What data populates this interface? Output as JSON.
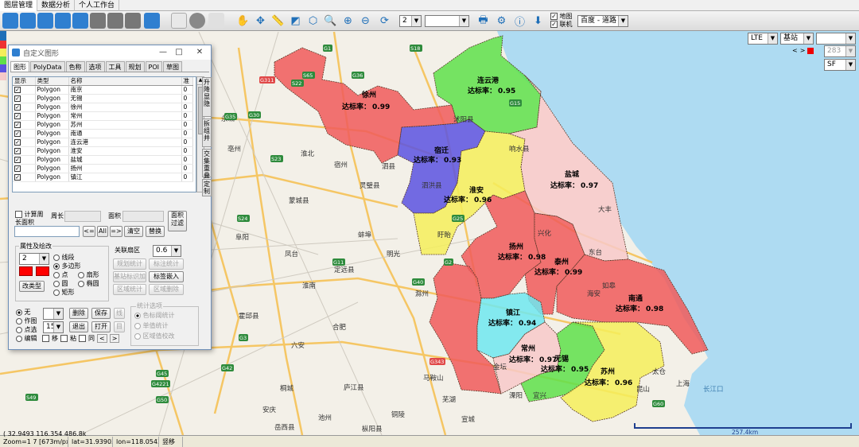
{
  "menu": {
    "tabs": [
      "图层管理",
      "数据分析",
      "个人工作台"
    ]
  },
  "toolbar": {
    "zoom_select": "2",
    "blank_select": "",
    "layer_map_label": "地图",
    "online_label": "联机",
    "basemap_select": "百度 - 道路"
  },
  "map_controls": {
    "network_select": "LTE",
    "site_select": "基站",
    "blank_select": "",
    "value_283": "283",
    "sf_select": "SF",
    "nav_arrows": [
      "<",
      ">"
    ]
  },
  "dialog": {
    "title": "自定义图形",
    "window_buttons": [
      "—",
      "□",
      "✕"
    ],
    "tabs": [
      "图形",
      "PolyData",
      "色称",
      "选项",
      "工具",
      "规划",
      "POI",
      "草图"
    ],
    "grid": {
      "headers": [
        "显示",
        "类型",
        "名称",
        "准"
      ],
      "rows": [
        {
          "type": "Polygon",
          "name": "南京",
          "v": "0"
        },
        {
          "type": "Polygon",
          "name": "无锡",
          "v": "0"
        },
        {
          "type": "Polygon",
          "name": "徐州",
          "v": "0"
        },
        {
          "type": "Polygon",
          "name": "常州",
          "v": "0"
        },
        {
          "type": "Polygon",
          "name": "苏州",
          "v": "0"
        },
        {
          "type": "Polygon",
          "name": "南通",
          "v": "0"
        },
        {
          "type": "Polygon",
          "name": "连云港",
          "v": "0"
        },
        {
          "type": "Polygon",
          "name": "淮安",
          "v": "0"
        },
        {
          "type": "Polygon",
          "name": "盐城",
          "v": "0"
        },
        {
          "type": "Polygon",
          "name": "扬州",
          "v": "0"
        },
        {
          "type": "Polygon",
          "name": "镇江",
          "v": "0"
        }
      ]
    },
    "side_buttons": [
      "升降显隐",
      "拆组并",
      "交集重叠",
      "定制"
    ],
    "calc_perimeter": "计算周长面积",
    "perimeter_label": "周长",
    "area_label": "面积",
    "area_filter": "面积过滤",
    "btn_left": "<=",
    "btn_all": "All",
    "btn_right": "=>",
    "btn_clear": "清空",
    "btn_replace": "替换",
    "attr_label": "属性及绘改",
    "attr_select": "2",
    "shape_options": [
      "线段",
      "多边形",
      "点",
      "扇形",
      "圆",
      "椭圆",
      "矩形"
    ],
    "change_type": "改类型",
    "link_label": "关联扇区",
    "link_value": "0.6",
    "btn_plan_stats": "规划统计",
    "btn_label_stats": "标注统计",
    "btn_station_add": "基站标识加",
    "btn_label_embed": "标签嵌入",
    "btn_area_stats": "区域统计",
    "btn_area_delete": "区域删除",
    "mode_options": [
      "无",
      "作图",
      "点选",
      "编辑"
    ],
    "spin_value": "15",
    "btn_delete": "删除",
    "btn_save": "保存",
    "btn_exit": "退出",
    "btn_open": "打开",
    "btn_small1": "线",
    "btn_small2": "目",
    "chk_move": "移",
    "chk_paste": "粘",
    "chk_same": "同",
    "stats_options_label": "统计选项",
    "stats_options": [
      "色标阈统计",
      "单值统计",
      "区域值校改"
    ]
  },
  "map": {
    "cities": [
      {
        "name": "徐州",
        "rate_label": "达标率：",
        "rate": "0.99",
        "color": "#f05a5a"
      },
      {
        "name": "连云港",
        "rate_label": "达标率：",
        "rate": "0.95",
        "color": "#5ee04a"
      },
      {
        "name": "宿迁",
        "rate_label": "达标率：",
        "rate": "0.93",
        "color": "#5a52e0"
      },
      {
        "name": "盐城",
        "rate_label": "达标率：",
        "rate": "0.97",
        "color": "#f7c9c9"
      },
      {
        "name": "淮安",
        "rate_label": "达标率：",
        "rate": "0.96",
        "color": "#f5ef5a"
      },
      {
        "name": "扬州",
        "rate_label": "达标率：",
        "rate": "0.98",
        "color": "#f05a5a"
      },
      {
        "name": "泰州",
        "rate_label": "达标率：",
        "rate": "0.99",
        "color": "#f05a5a"
      },
      {
        "name": "南通",
        "rate_label": "达标率：",
        "rate": "0.98",
        "color": "#f05a5a"
      },
      {
        "name": "镇江",
        "rate_label": "达标率：",
        "rate": "0.94",
        "color": "#6ee8f0"
      },
      {
        "name": "常州",
        "rate_label": "达标率：",
        "rate": "0.97",
        "color": "#f7c9c9"
      },
      {
        "name": "无锡",
        "rate_label": "达标率：",
        "rate": "0.95",
        "color": "#5ee04a"
      },
      {
        "name": "苏州",
        "rate_label": "达标率：",
        "rate": "0.96",
        "color": "#f5ef5a"
      },
      {
        "name": "南京",
        "rate_label": "",
        "rate": "",
        "color": "#f05a5a"
      }
    ],
    "place_labels": [
      "淮北",
      "宿州",
      "蚌埠",
      "阜阳",
      "六安",
      "合肥",
      "芜湖",
      "铜陵",
      "池州",
      "安庆",
      "马鞍山",
      "滁州",
      "宣城",
      "上海",
      "长江口",
      "大丰",
      "如皋",
      "泗洪县",
      "明光",
      "定远县",
      "盱眙",
      "庐江县",
      "桐城",
      "岳西县",
      "枞阳县",
      "淮南",
      "霍邱县",
      "蒙城县",
      "亳州",
      "商丘",
      "灵璧县",
      "泗县",
      "凤台",
      "永城",
      "睢县",
      "沭阳县",
      "响水县",
      "东台",
      "兴化",
      "海安",
      "金坛",
      "溧阳",
      "宜兴",
      "昆山",
      "太仓"
    ],
    "road_shields": [
      "S65",
      "G30",
      "G35",
      "G15",
      "G2",
      "G25",
      "G40",
      "G42",
      "S49",
      "G3",
      "G50",
      "G60",
      "G4221",
      "S22",
      "S23",
      "S24",
      "G36",
      "G45",
      "S18",
      "G1",
      "G11",
      "G311",
      "G343"
    ],
    "scale_label": "257.4km"
  },
  "status": {
    "coords": "( 32.9493 116.354 486.8km )",
    "zoom": "Zoom=1 7 [673m/px]",
    "lat": "lat=31.93903",
    "lon": "lon=118.0543",
    "mode": "竖移"
  }
}
